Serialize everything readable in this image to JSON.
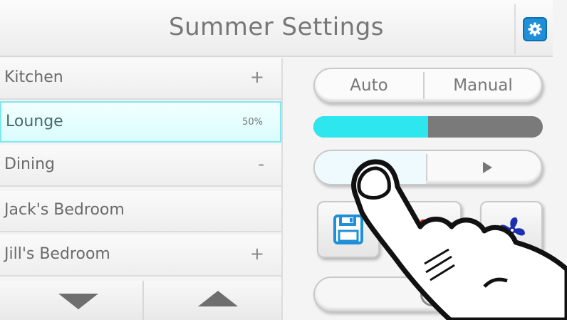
{
  "header": {
    "title": "Summer Settings",
    "settings_icon": "gear-icon"
  },
  "rooms": [
    {
      "name": "Kitchen",
      "value": "+",
      "active": false
    },
    {
      "name": "Lounge",
      "value": "50%",
      "active": true
    },
    {
      "name": "Dining",
      "value": "-",
      "active": false
    },
    {
      "name": "Jack's Bedroom",
      "value": "",
      "active": false
    },
    {
      "name": "Jill's Bedroom",
      "value": "+",
      "active": false
    }
  ],
  "list_nav": {
    "down_icon": "triangle-down-icon",
    "up_icon": "triangle-up-icon"
  },
  "mode": {
    "options": [
      "Auto",
      "Manual"
    ],
    "selected": "Manual"
  },
  "progress": {
    "value_percent": 50
  },
  "playback": {
    "play_icon": "play-icon"
  },
  "actions": {
    "save_icon": "floppy-disk-icon",
    "delete_icon": "stop-icon",
    "fan_icon": "fan-icon"
  },
  "colors": {
    "accent": "#2ee6ee",
    "settings_button": "#1e8fd8",
    "active_row": "#dafcfc",
    "fan_blue": "#1b2fb0",
    "save_blue": "#1e8fd8",
    "stop_red": "#e0202a"
  }
}
